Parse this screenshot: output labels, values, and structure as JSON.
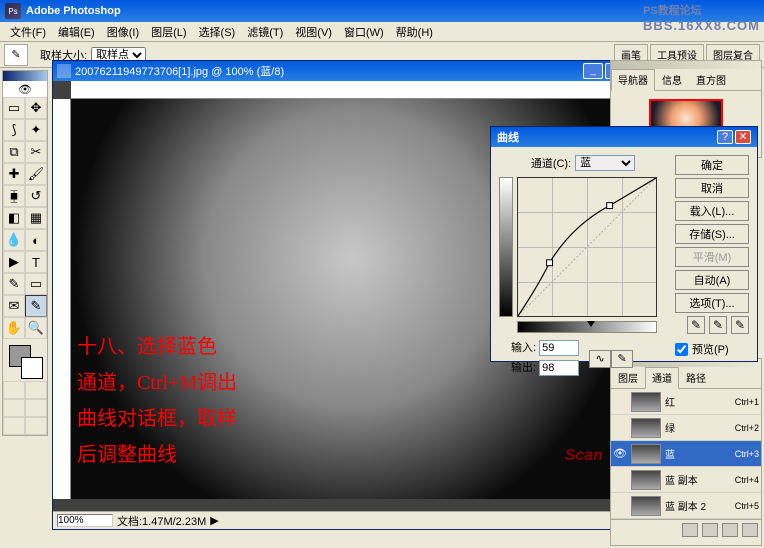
{
  "app_title": "Adobe Photoshop",
  "watermark": {
    "line1": "PS教程论坛",
    "line2": "BBS.16XX8.COM"
  },
  "menu": [
    "文件(F)",
    "编辑(E)",
    "图像(I)",
    "图层(L)",
    "选择(S)",
    "滤镜(T)",
    "视图(V)",
    "窗口(W)",
    "帮助(H)"
  ],
  "options": {
    "label_sample_size": "取样大小:",
    "sample_value": "取样点",
    "right_tabs": [
      "画笔",
      "工具预设",
      "图层复合"
    ]
  },
  "document": {
    "title": "20076211949773706[1].jpg @ 100% (蓝/8)",
    "zoom": "100%",
    "filesize": "文档:1.47M/2.23M",
    "overlay_text": "十八、选择蓝色\n通道，Ctrl+M调出\n曲线对话框，取样\n后调整曲线",
    "logo": "Scan"
  },
  "navigator": {
    "tabs": [
      "导航器",
      "信息",
      "直方图"
    ]
  },
  "curves": {
    "title": "曲线",
    "channel_label": "通道(C):",
    "channel_value": "蓝",
    "input_label": "输入:",
    "output_label": "输出:",
    "input_value": "59",
    "output_value": "98",
    "btn_ok": "确定",
    "btn_cancel": "取消",
    "btn_load": "载入(L)...",
    "btn_save": "存储(S)...",
    "btn_smooth": "平滑(M)",
    "btn_auto": "自动(A)",
    "btn_options": "选项(T)...",
    "preview_label": "预览(P)"
  },
  "channels": {
    "tabs": [
      "图层",
      "通道",
      "路径"
    ],
    "rows": [
      {
        "name": "红",
        "key": "Ctrl+1",
        "sel": false
      },
      {
        "name": "绿",
        "key": "Ctrl+2",
        "sel": false
      },
      {
        "name": "蓝",
        "key": "Ctrl+3",
        "sel": true
      },
      {
        "name": "蓝 副本",
        "key": "Ctrl+4",
        "sel": false
      },
      {
        "name": "蓝 副本 2",
        "key": "Ctrl+5",
        "sel": false
      }
    ]
  },
  "chart_data": {
    "type": "line",
    "title": "曲线",
    "xlabel": "输入",
    "ylabel": "输出",
    "xlim": [
      0,
      255
    ],
    "ylim": [
      0,
      255
    ],
    "series": [
      {
        "name": "蓝",
        "x": [
          0,
          59,
          170,
          255
        ],
        "y": [
          0,
          98,
          205,
          255
        ]
      }
    ]
  }
}
